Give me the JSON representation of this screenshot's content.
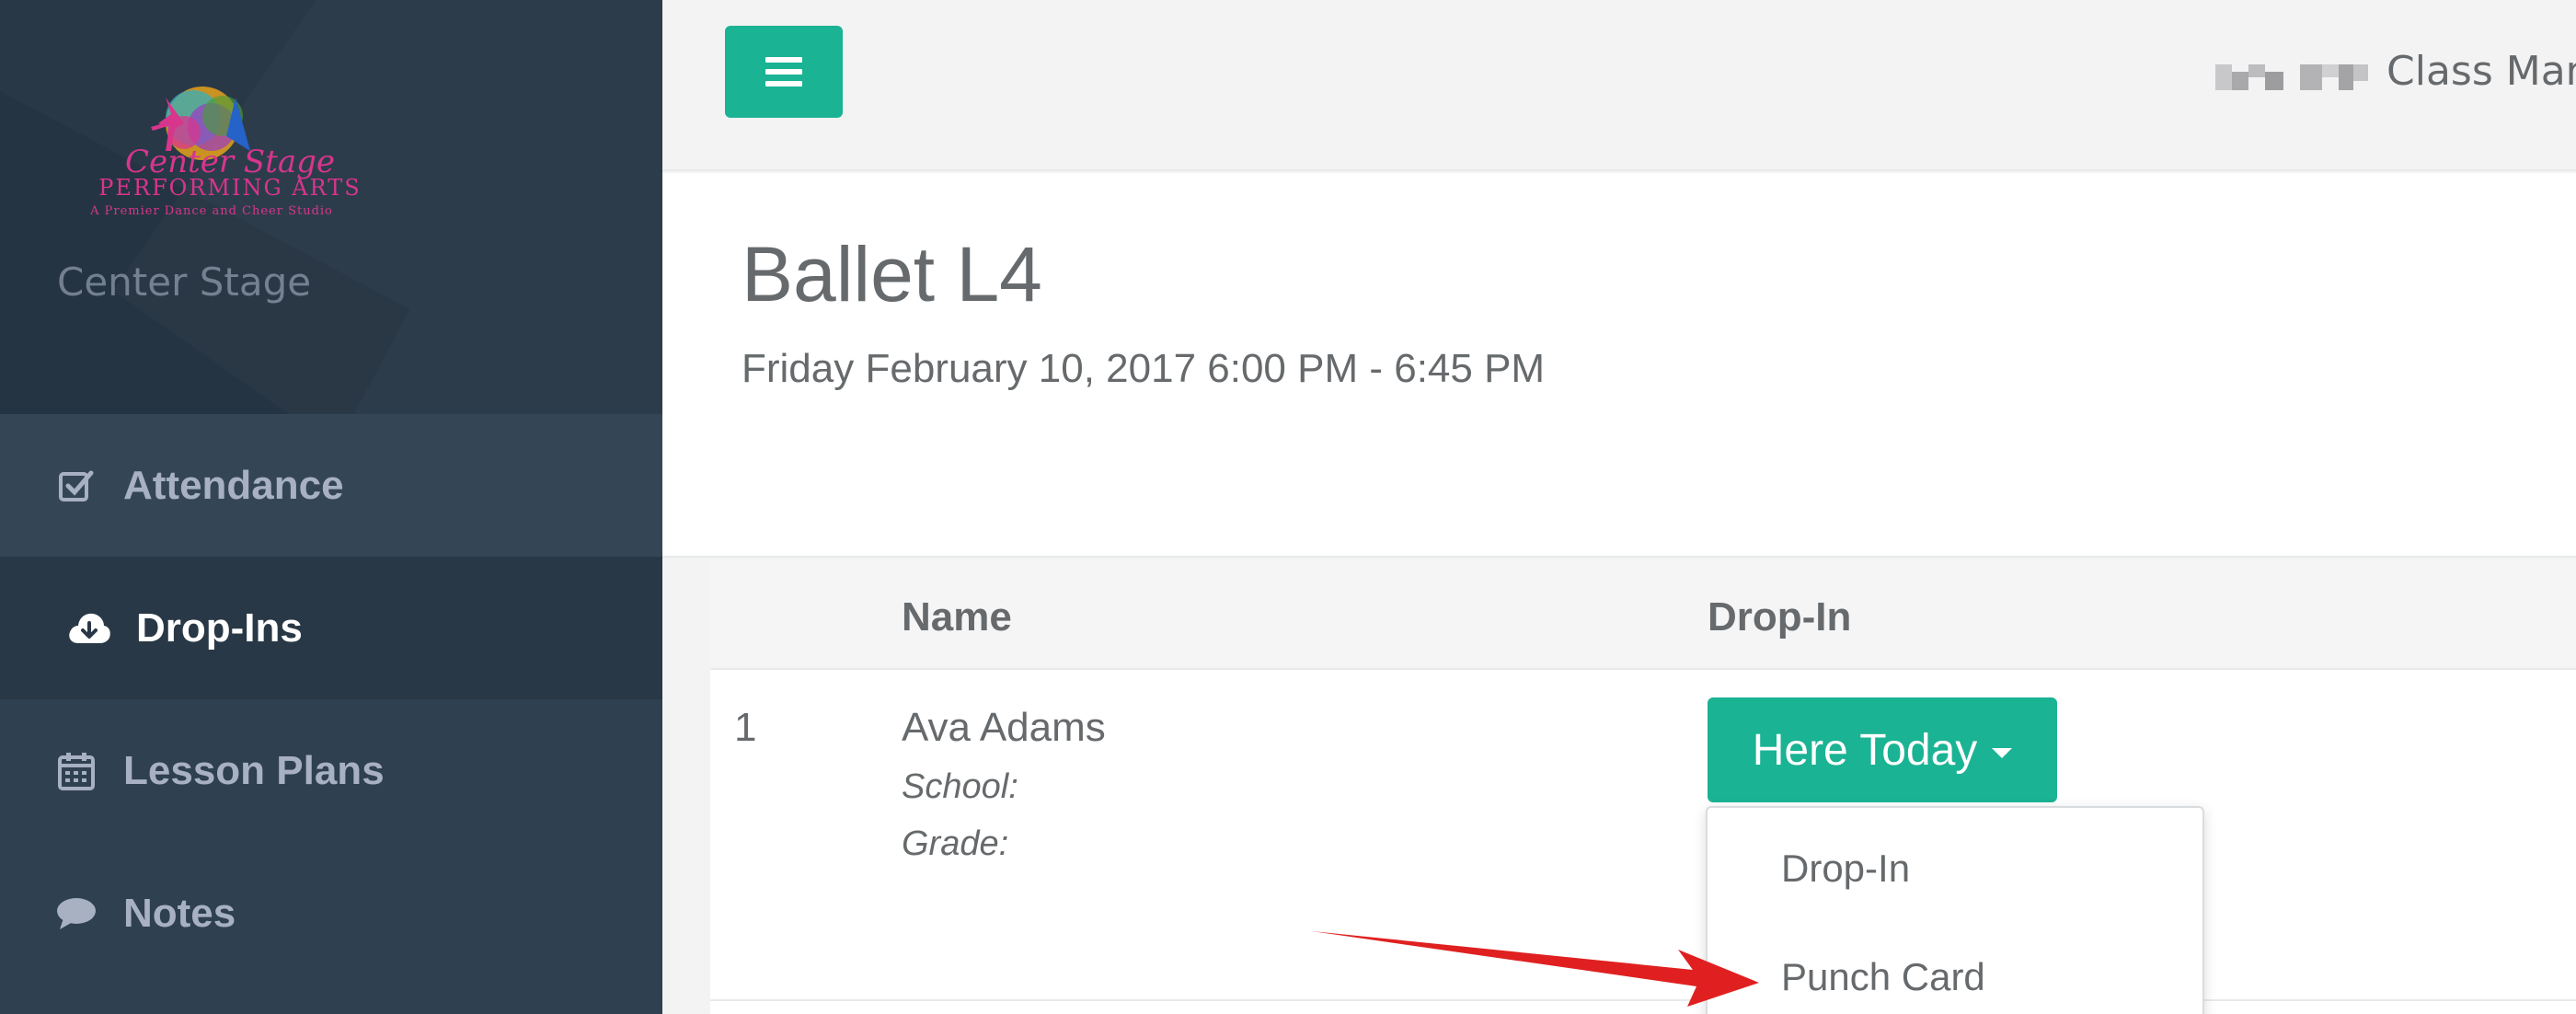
{
  "sidebar": {
    "logo": {
      "title": "Center Stage",
      "subtitle": "PERFORMING ARTS",
      "tagline": "A Premier Dance and Cheer Studio"
    },
    "org_name": "Center Stage",
    "items": [
      {
        "label": "Attendance",
        "icon": "check-square-icon"
      },
      {
        "label": "Drop-Ins",
        "icon": "cloud-download-icon",
        "active": true
      },
      {
        "label": "Lesson Plans",
        "icon": "calendar-icon"
      },
      {
        "label": "Notes",
        "icon": "comment-icon"
      }
    ]
  },
  "topbar": {
    "menu_icon": "hamburger-icon",
    "title": "Class Man"
  },
  "page": {
    "class_title": "Ballet L4",
    "datetime": "Friday February 10, 2017 6:00 PM - 6:45 PM"
  },
  "table": {
    "headers": [
      "",
      "Name",
      "Drop-In"
    ],
    "rows": [
      {
        "number": "1",
        "name": "Ava Adams",
        "school_label": "School:",
        "grade_label": "Grade:",
        "status_button": "Here Today"
      }
    ]
  },
  "dropdown": {
    "options": [
      "Drop-In",
      "Punch Card"
    ]
  },
  "colors": {
    "accent": "#1ab394",
    "sidebar": "#2f4050",
    "annotation_arrow": "#e02020"
  }
}
